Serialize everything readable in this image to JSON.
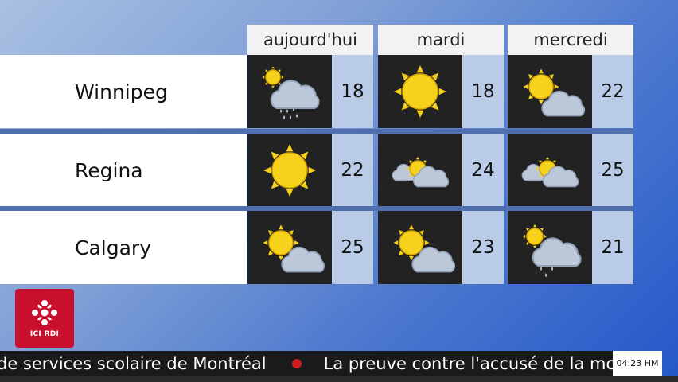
{
  "forecast": {
    "days": [
      "aujourd'hui",
      "mardi",
      "mercredi"
    ],
    "cities": [
      {
        "name": "Winnipeg",
        "cells": [
          {
            "icon": "rain-partly-sunny-icon",
            "temp": "18"
          },
          {
            "icon": "sun-icon",
            "temp": "18"
          },
          {
            "icon": "partly-cloudy-icon",
            "temp": "22"
          }
        ]
      },
      {
        "name": "Regina",
        "cells": [
          {
            "icon": "sun-icon",
            "temp": "22"
          },
          {
            "icon": "mostly-cloudy-icon",
            "temp": "24"
          },
          {
            "icon": "mostly-cloudy-icon",
            "temp": "25"
          }
        ]
      },
      {
        "name": "Calgary",
        "cells": [
          {
            "icon": "partly-cloudy-icon",
            "temp": "25"
          },
          {
            "icon": "partly-cloudy-icon",
            "temp": "23"
          },
          {
            "icon": "showers-icon",
            "temp": "21"
          }
        ]
      }
    ]
  },
  "logo": {
    "text": "ICI RDI",
    "color": "#c8102e"
  },
  "ticker": {
    "item1": "de services scolaire de Montréal",
    "item2": "La preuve contre l'accusé de la mo"
  },
  "clock": {
    "time": "04:23 HM"
  },
  "colors": {
    "icon_bg": "#222222",
    "temp_bg": "#b9cbe6",
    "sun": "#f7d21c",
    "logo_red": "#c8102e"
  }
}
